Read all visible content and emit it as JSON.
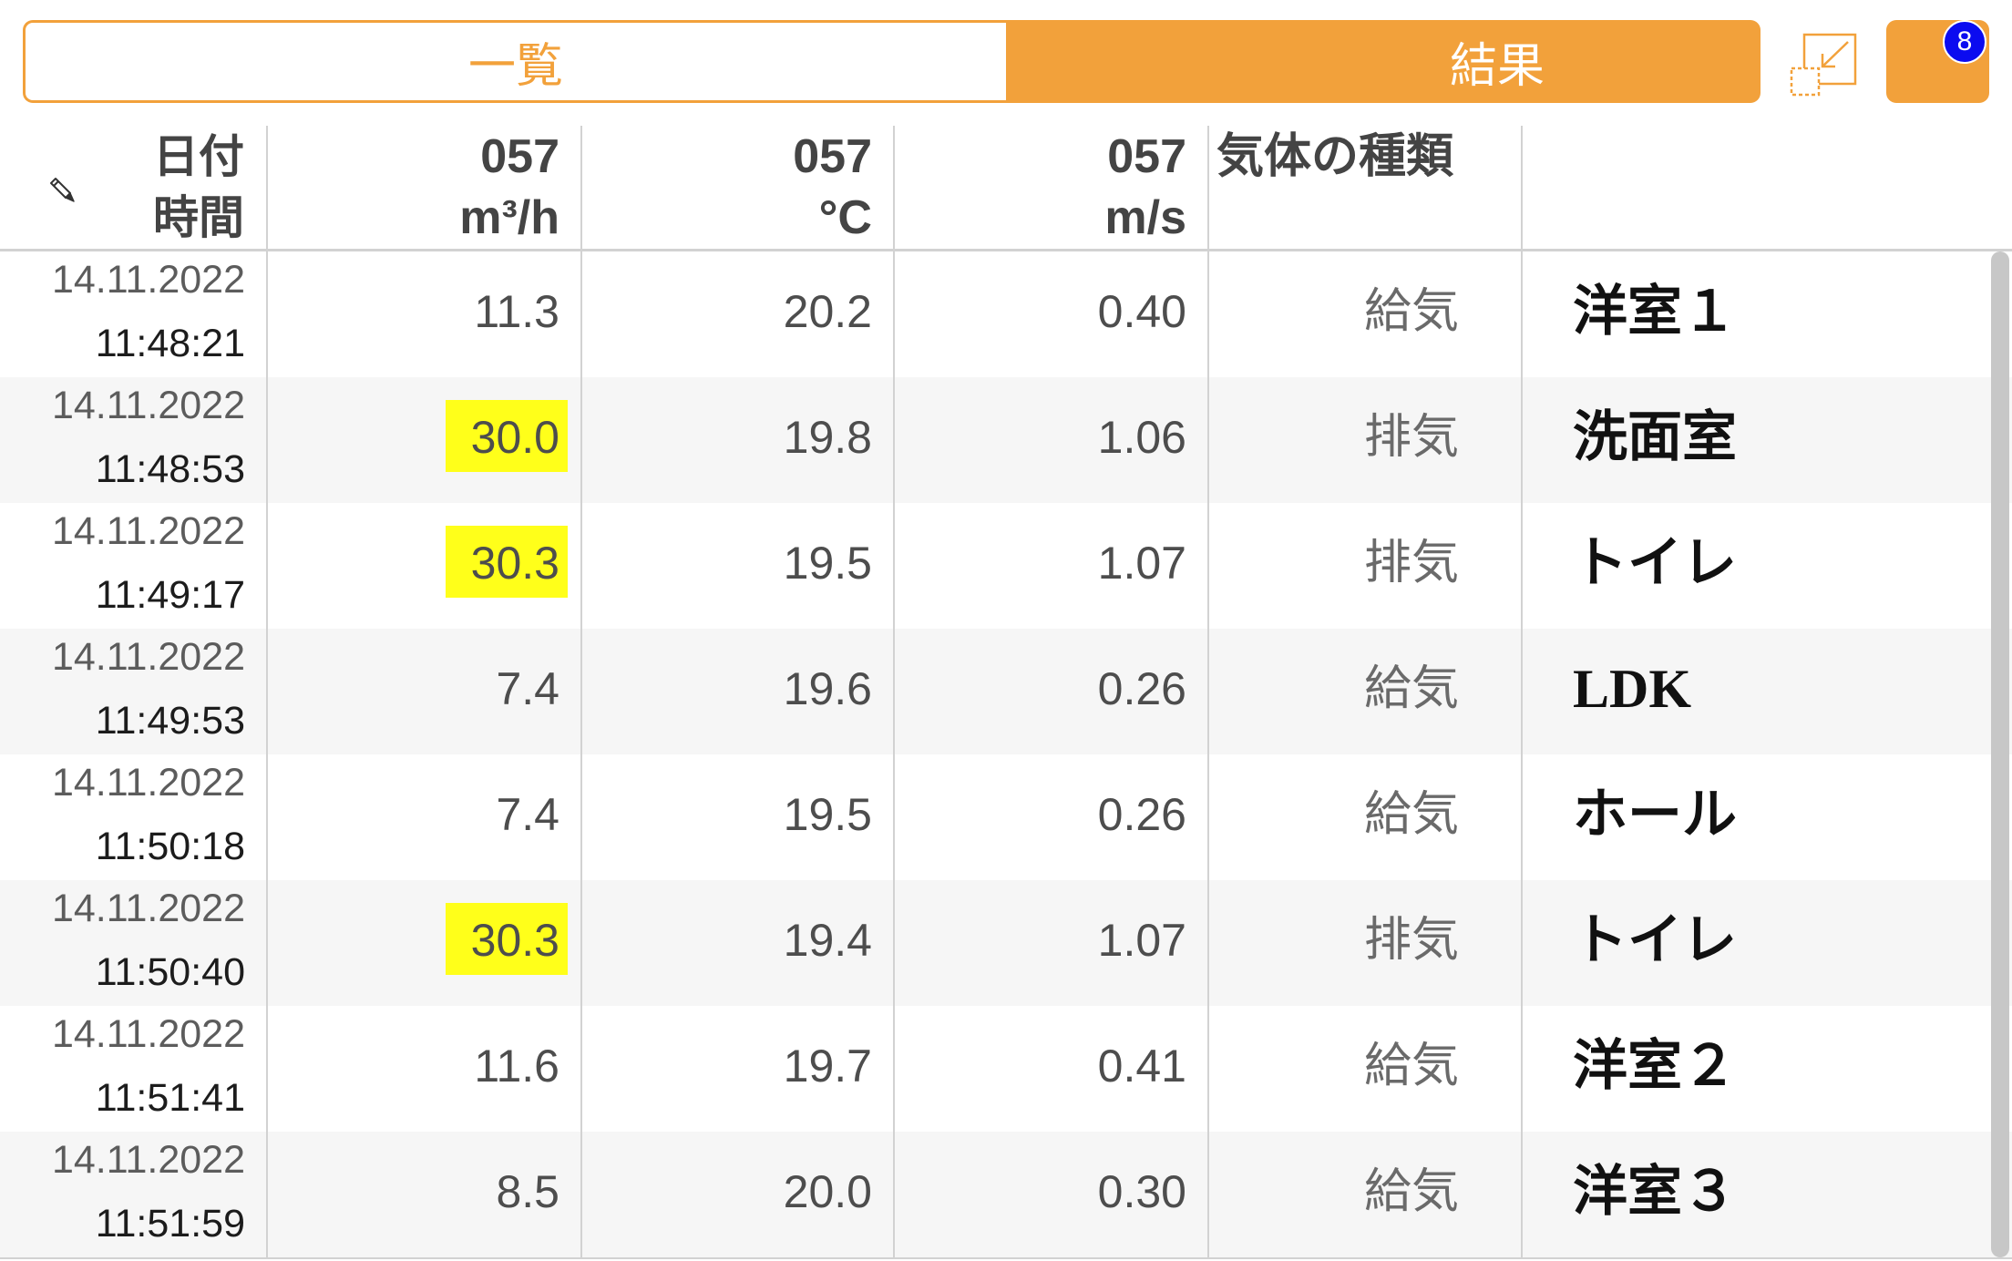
{
  "colors": {
    "accent": "#F2A13B",
    "badge": "#0B0BF0",
    "highlight": "#FFFF1A",
    "row_stripe": "#F6F6F6",
    "grid_line": "#D2D2D2"
  },
  "tabs": [
    {
      "label": "一覧",
      "active": false
    },
    {
      "label": "結果",
      "active": true
    }
  ],
  "toolbar": {
    "collapse_icon": "collapse-icon",
    "badge_count": "8"
  },
  "table": {
    "header": {
      "edit_icon": "pencil-icon",
      "date_label": "日付",
      "time_label": "時間",
      "measure_columns": [
        {
          "probe": "057",
          "unit": "m³/h"
        },
        {
          "probe": "057",
          "unit": "°C"
        },
        {
          "probe": "057",
          "unit": "m/s"
        }
      ],
      "type_label": "気体の種類"
    },
    "rows": [
      {
        "date": "14.11.2022",
        "time": "11:48:21",
        "airflow": "11.3",
        "airflow_highlighted": false,
        "temperature": "20.2",
        "velocity": "0.40",
        "gas_type": "給気",
        "location": "洋室１"
      },
      {
        "date": "14.11.2022",
        "time": "11:48:53",
        "airflow": "30.0",
        "airflow_highlighted": true,
        "temperature": "19.8",
        "velocity": "1.06",
        "gas_type": "排気",
        "location": "洗面室"
      },
      {
        "date": "14.11.2022",
        "time": "11:49:17",
        "airflow": "30.3",
        "airflow_highlighted": true,
        "temperature": "19.5",
        "velocity": "1.07",
        "gas_type": "排気",
        "location": "トイレ"
      },
      {
        "date": "14.11.2022",
        "time": "11:49:53",
        "airflow": "7.4",
        "airflow_highlighted": false,
        "temperature": "19.6",
        "velocity": "0.26",
        "gas_type": "給気",
        "location": "LDK"
      },
      {
        "date": "14.11.2022",
        "time": "11:50:18",
        "airflow": "7.4",
        "airflow_highlighted": false,
        "temperature": "19.5",
        "velocity": "0.26",
        "gas_type": "給気",
        "location": "ホール"
      },
      {
        "date": "14.11.2022",
        "time": "11:50:40",
        "airflow": "30.3",
        "airflow_highlighted": true,
        "temperature": "19.4",
        "velocity": "1.07",
        "gas_type": "排気",
        "location": "トイレ"
      },
      {
        "date": "14.11.2022",
        "time": "11:51:41",
        "airflow": "11.6",
        "airflow_highlighted": false,
        "temperature": "19.7",
        "velocity": "0.41",
        "gas_type": "給気",
        "location": "洋室２"
      },
      {
        "date": "14.11.2022",
        "time": "11:51:59",
        "airflow": "8.5",
        "airflow_highlighted": false,
        "temperature": "20.0",
        "velocity": "0.30",
        "gas_type": "給気",
        "location": "洋室３"
      }
    ]
  }
}
